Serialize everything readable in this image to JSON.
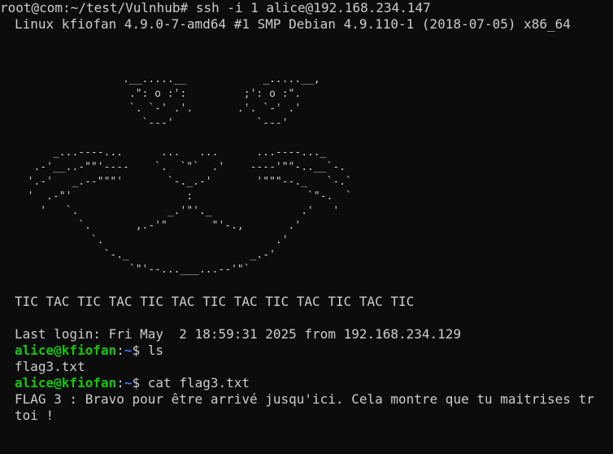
{
  "terminal": {
    "ssh_command": "root@com:~/test/Vulnhub# ssh -i 1 alice@192.168.234.147",
    "banner": "Linux kfiofan 4.9.0-7-amd64 #1 SMP Debian 4.9.110-1 (2018-07-05) x86_64",
    "ascii_art": [
      "                 .__.....__            _.....__,",
      "                  .\": o :':         ;': o :\".",
      "                  `. `-' .'.       .'. `-' .'",
      "                    `---'             `---'",
      "",
      "      _...----...      ...   ...      ...----..._",
      "   .-'__..-\"\"'----    `.  `\"`  .'    ----'\"\"-..__`-.",
      "  '.-'   _.--\"\"\"'       `-._.-'       '\"\"\"--._   `-.`",
      "  '  .-\"'                  :                  `\"-.  `",
      "    '   `.              _.'\"'._              .'   '",
      "          `.       ,.-'\"       \"'-.,       .'",
      "            `.                           .'",
      "              `-._                   _.-'",
      "                  `\"'--...___...--'\"`"
    ],
    "tic_tac": "TIC TAC TIC TAC TIC TAC TIC TAC TIC TAC TIC TAC TIC",
    "last_login": "Last login: Fri May  2 18:59:31 2025 from 192.168.234.129",
    "prompt_user": "alice@kfiofan",
    "prompt_colon": ":",
    "prompt_path": "~",
    "prompt_symbol": "$ ",
    "cmd1": "ls",
    "ls_output": "flag3.txt",
    "cmd2": "cat flag3.txt",
    "flag_line1": "FLAG 3 : Bravo pour être arrivé jusqu'ici. Cela montre que tu maitrises tr",
    "flag_line2": "toi !"
  }
}
